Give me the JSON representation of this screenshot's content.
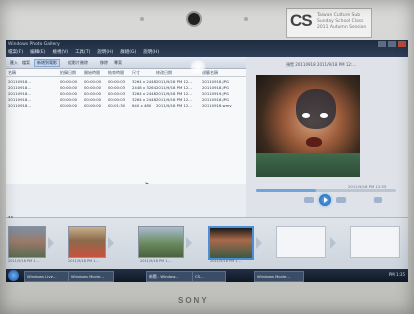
{
  "window": {
    "title": "Windows Photo Gallery"
  },
  "menubar": [
    "檔案(F)",
    "編輯(E)",
    "檢視(V)",
    "工具(T)",
    "說明(H)",
    "群組(G)",
    "說明(H)"
  ],
  "toolbar": {
    "items": [
      "匯入",
      "檔案",
      "新增到電影",
      "從影片刪除",
      "移除",
      "專案"
    ]
  },
  "filelist": {
    "columns": [
      "名稱",
      "拍攝日期",
      "開始時間",
      "結束時間",
      "尺寸",
      "修改日期",
      "標籤名稱"
    ],
    "rows": [
      [
        "20110918...",
        "00:00:00",
        "00:00:00",
        "00:00:03",
        "3264 x 2448",
        "2011/9/18 PM 12...",
        "20110918.JPG"
      ],
      [
        "20110918...",
        "00:00:00",
        "00:00:00",
        "00:00:03",
        "2448 x 3264",
        "2011/9/18 PM 12...",
        "20110918.JPG"
      ],
      [
        "20110918...",
        "00:00:00",
        "00:00:00",
        "00:00:03",
        "3264 x 2448",
        "2011/9/18 PM 12...",
        "20110919.JPG"
      ],
      [
        "20110918...",
        "00:00:00",
        "00:00:00",
        "00:00:03",
        "3264 x 2448",
        "2011/9/18 PM 12...",
        "20110918.JPG"
      ],
      [
        "20110918...",
        "00:00:00",
        "00:00:00",
        "00:01:30",
        "640 x 480",
        "2011/9/18 PM 12...",
        "20110918.wmv"
      ]
    ]
  },
  "preview": {
    "title": "預覽 20110918 2011/9/18 PM 12:...",
    "date": "2011/9/18 PM 12:55"
  },
  "timeline": {
    "captions": [
      "2011/9/18 PM 1...",
      "2011/9/18 PM 1...",
      "2011/9/18 PM 1...",
      "2011/9/18 PM 1..."
    ]
  },
  "taskbar": {
    "items": [
      "Windows Live...",
      "Windows Movie...",
      "新聞 - Window...",
      "CS...",
      "Windows Movie..."
    ],
    "clock": "PM 1:35"
  },
  "laptop": {
    "brand": "SONY",
    "sticker_logo": "CS",
    "sticker_lines": [
      "Taiwan Culture Sub",
      "Sunday School Class",
      "2011 Autumn Session"
    ]
  },
  "colors": {
    "accent": "#4d8fd6",
    "titlebar": "#1e2c3f",
    "taskbar": "#0f1826"
  }
}
